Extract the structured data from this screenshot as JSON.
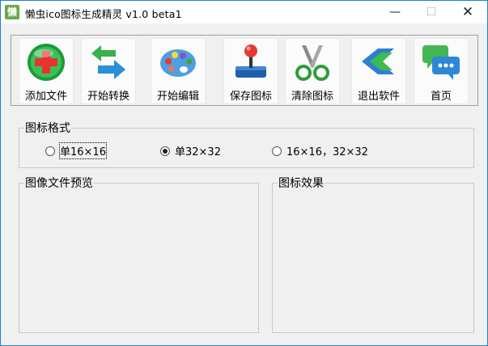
{
  "window": {
    "app_icon_char": "懒",
    "title": "懒虫ico图标生成精灵 v1.0 beta1",
    "minimize_glyph": "—",
    "maximize_glyph": "☐",
    "close_glyph": "✕"
  },
  "toolbar": {
    "buttons": [
      {
        "label": "添加文件",
        "icon": "add-file-icon"
      },
      {
        "label": "开始转换",
        "icon": "convert-arrows-icon"
      },
      {
        "label": "开始编辑",
        "icon": "palette-icon"
      },
      {
        "label": "保存图标",
        "icon": "joystick-icon"
      },
      {
        "label": "清除图标",
        "icon": "scissors-icon"
      },
      {
        "label": "退出软件",
        "icon": "exit-arrow-icon"
      },
      {
        "label": "首页",
        "icon": "chat-bubbles-icon"
      }
    ]
  },
  "format_group": {
    "title": "图标格式",
    "options": [
      {
        "label": "单16×16",
        "selected": false
      },
      {
        "label": "单32×32",
        "selected": true
      },
      {
        "label": "16×16，32×32",
        "selected": false
      }
    ]
  },
  "preview_group": {
    "title": "图像文件预览"
  },
  "effect_group": {
    "title": "图标效果"
  }
}
